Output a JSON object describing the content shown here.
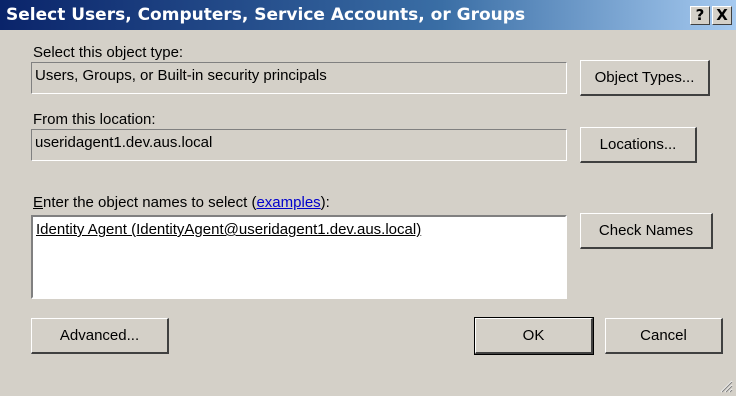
{
  "window": {
    "title": "Select Users, Computers, Service Accounts, or Groups",
    "help_button": "?",
    "close_button": "X"
  },
  "object_type": {
    "label": "Select this object type:",
    "value": "Users, Groups, or Built-in security principals",
    "button": "Object Types..."
  },
  "location": {
    "label": "From this location:",
    "value": "useridagent1.dev.aus.local",
    "button": "Locations..."
  },
  "names": {
    "label_mnemonic": "E",
    "label_rest": "nter the object names to select (",
    "examples_link": "examples",
    "label_end": "):",
    "value": "Identity Agent (IdentityAgent@useridagent1.dev.aus.local)",
    "check_button": "Check Names"
  },
  "footer": {
    "advanced": "Advanced...",
    "ok": "OK",
    "cancel": "Cancel"
  }
}
